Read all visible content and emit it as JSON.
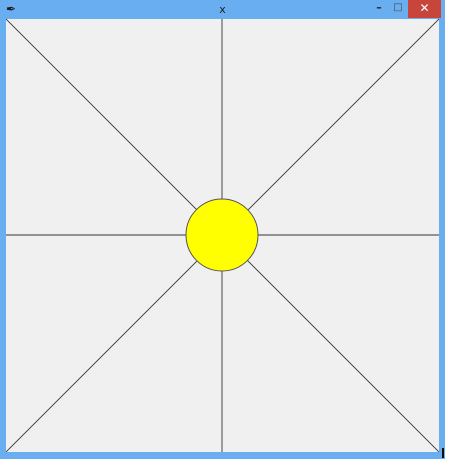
{
  "window": {
    "title": "x",
    "app_icon": "feather-icon",
    "controls": {
      "minimize": "–",
      "maximize": "□",
      "close": "✕"
    }
  },
  "canvas": {
    "background": "#f0f0f0",
    "line_color": "#333333",
    "circle_fill": "#ffff00",
    "circle_stroke": "#555555"
  }
}
